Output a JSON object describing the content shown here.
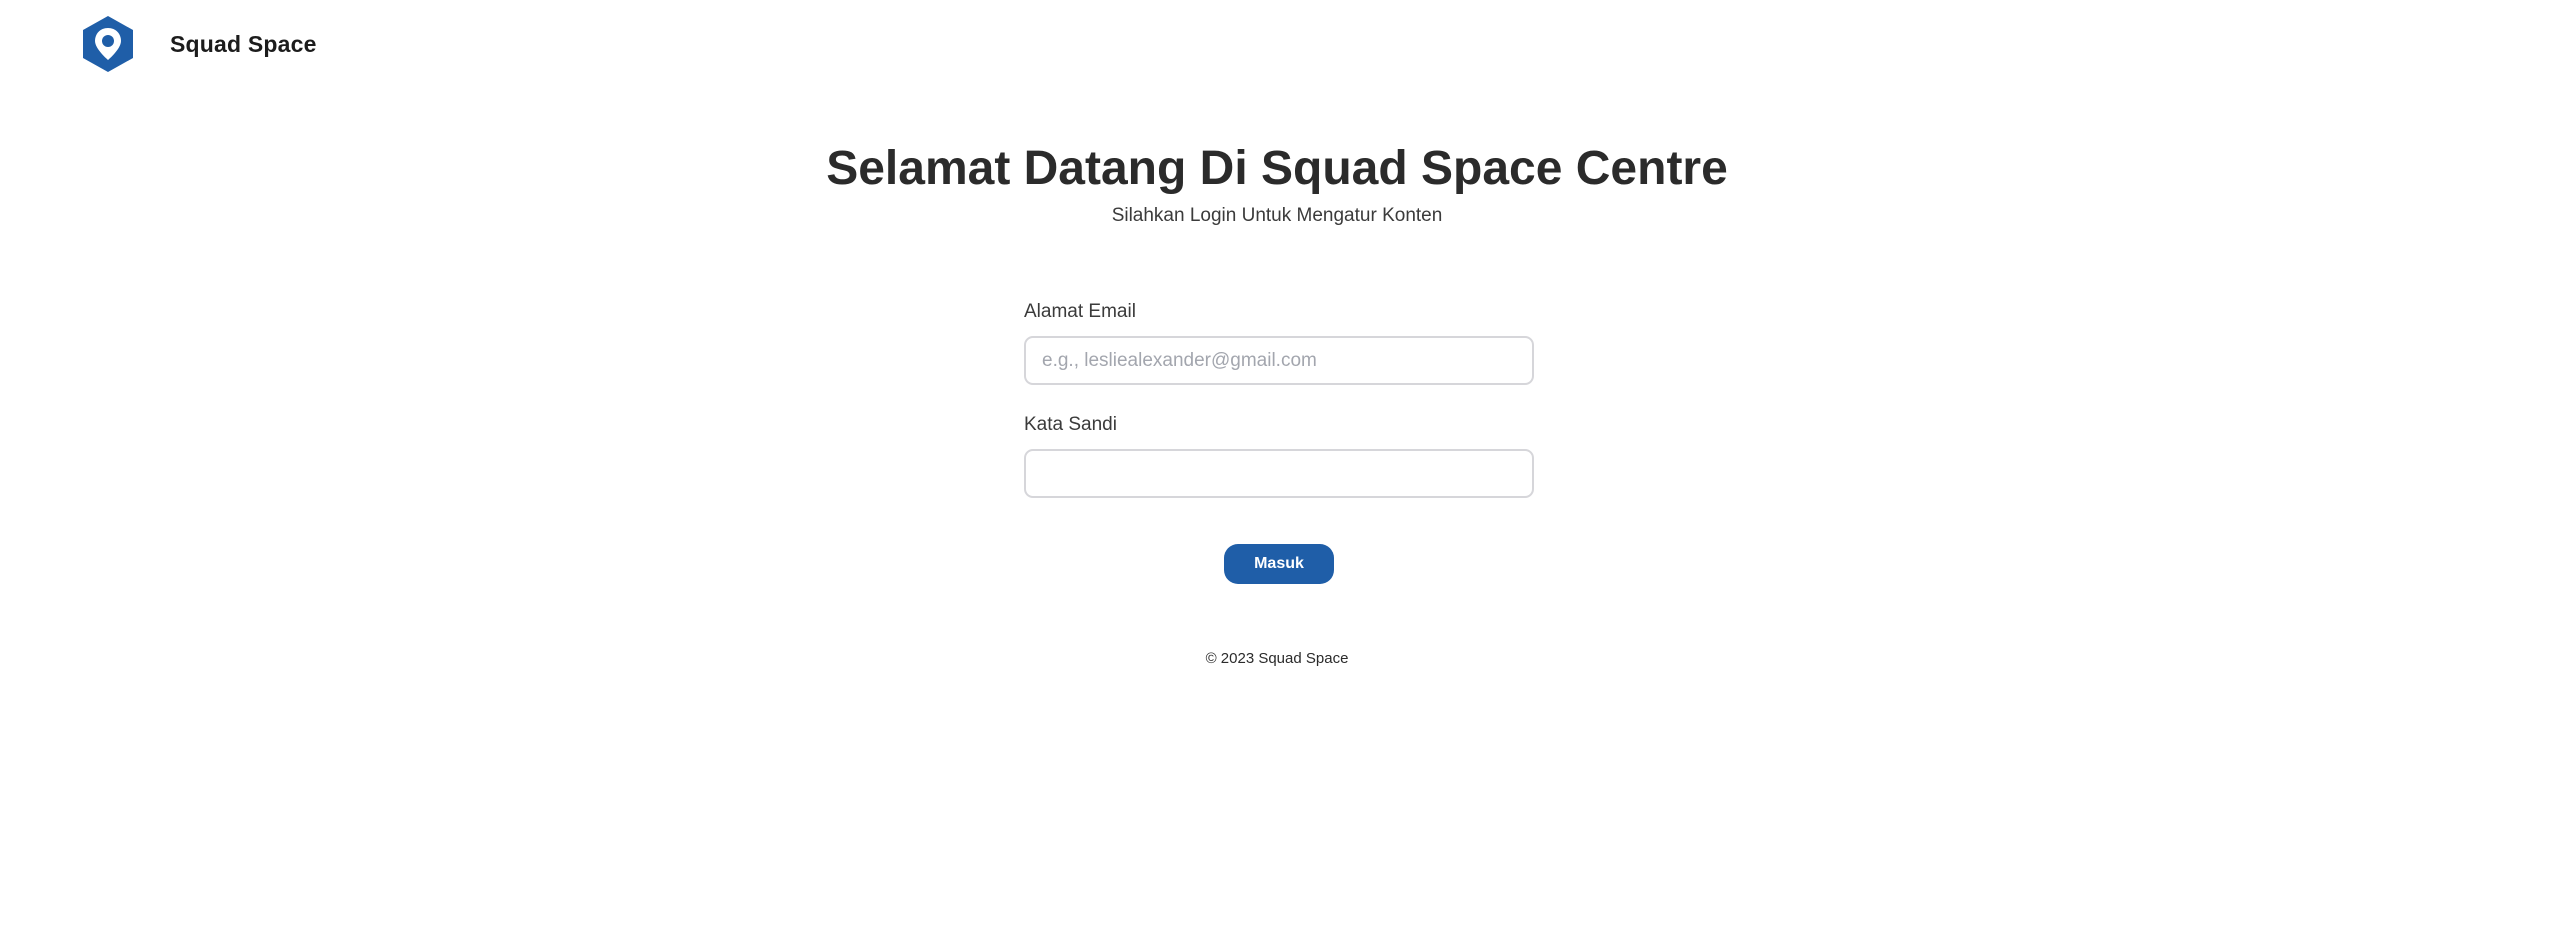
{
  "header": {
    "brand_name": "Squad Space",
    "logo_icon": "location-pin-hexagon-icon"
  },
  "hero": {
    "title": "Selamat Datang Di Squad Space Centre",
    "subtitle": "Silahkan Login Untuk Mengatur Konten"
  },
  "form": {
    "email_label": "Alamat Email",
    "email_placeholder": "e.g., lesliealexander@gmail.com",
    "email_value": "",
    "password_label": "Kata Sandi",
    "password_value": "",
    "submit_label": "Masuk"
  },
  "footer": {
    "copyright": "© 2023 Squad Space"
  },
  "colors": {
    "accent": "#1f5ea8",
    "text": "#2b2b2b",
    "input_border": "#d6d6da",
    "placeholder": "#a3a6ae"
  }
}
